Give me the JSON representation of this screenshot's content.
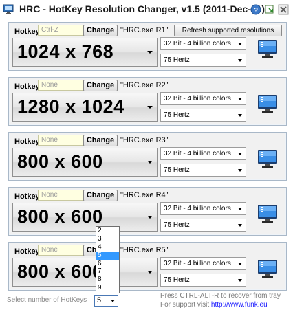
{
  "window": {
    "title": "HRC - HotKey Resolution Changer, v1.5 (2011-Dec-31)",
    "icons": [
      "app-icon",
      "help-icon",
      "tray-icon",
      "close-icon"
    ]
  },
  "common": {
    "hotkey_label": "Hotkey",
    "change_label": "Change",
    "refresh_label": "Refresh supported resolutions",
    "monitor_icon": "monitor-icon"
  },
  "panels": [
    {
      "hotkey": "Ctrl-Z",
      "exe": "\"HRC.exe R1\"",
      "resolution": "1024 x 768",
      "color": "32 Bit - 4 billion colors",
      "refresh": "75 Hertz"
    },
    {
      "hotkey": "None",
      "exe": "\"HRC.exe R2\"",
      "resolution": "1280 x 1024",
      "color": "32 Bit - 4 billion colors",
      "refresh": "75 Hertz"
    },
    {
      "hotkey": "None",
      "exe": "\"HRC.exe R3\"",
      "resolution": "800 x 600",
      "color": "32 Bit - 4 billion colors",
      "refresh": "75 Hertz"
    },
    {
      "hotkey": "None",
      "exe": "\"HRC.exe R4\"",
      "resolution": "800 x 600",
      "color": "32 Bit - 4 billion colors",
      "refresh": "75 Hertz"
    },
    {
      "hotkey": "None",
      "exe": "\"HRC.exe R5\"",
      "resolution": "800 x 600",
      "color": "32 Bit - 4 billion colors",
      "refresh": "75 Hertz"
    }
  ],
  "footer": {
    "select_label": "Select number of HotKeys",
    "selected_count": "5",
    "options": [
      "2",
      "3",
      "4",
      "5",
      "6",
      "7",
      "8",
      "9"
    ],
    "note_recover": "Press  CTRL-ALT-R to recover from tray",
    "note_support": "For support visit",
    "support_link": "http://www.funk.eu"
  },
  "colors": {
    "accent": "#3399ff",
    "panel_bg": "#f1f1f1",
    "panel_border": "#a9b8c8",
    "hotkey_bg": "#ffffe1",
    "link": "#1c1cff"
  }
}
